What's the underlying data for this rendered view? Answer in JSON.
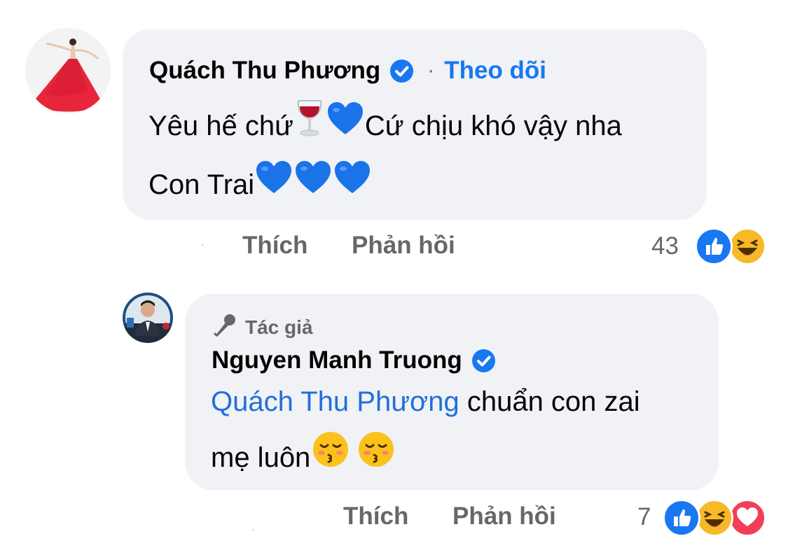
{
  "comment1": {
    "author": "Quách Thu Phương",
    "separator": "·",
    "follow_label": "Theo dõi",
    "line1_a": "Yêu hế chứ",
    "line1_b": "Cứ chịu khó vậy nha",
    "line2": "Con Trai",
    "emojis_line1": [
      "wine-glass",
      "blue-heart"
    ],
    "emojis_line2": [
      "blue-heart",
      "blue-heart",
      "blue-heart"
    ],
    "like_label": "Thích",
    "reply_label": "Phản hồi",
    "reaction_count": "43",
    "reactions": [
      "like",
      "haha"
    ]
  },
  "comment2": {
    "author_badge": "Tác giả",
    "author": "Nguyen Manh Truong",
    "mention": "Quách Thu Phương",
    "line1": " chuẩn con zai",
    "line2": "mẹ luôn",
    "emojis_line2": [
      "kissing-face",
      "kissing-face"
    ],
    "like_label": "Thích",
    "reply_label": "Phản hồi",
    "reaction_count": "7",
    "reactions": [
      "like",
      "haha",
      "love"
    ]
  },
  "colors": {
    "bubble": "#f0f2f5",
    "link_blue": "#1877f2",
    "mention_blue": "#216fdb",
    "muted": "#65676b",
    "blue_heart": "#1a73e8"
  }
}
